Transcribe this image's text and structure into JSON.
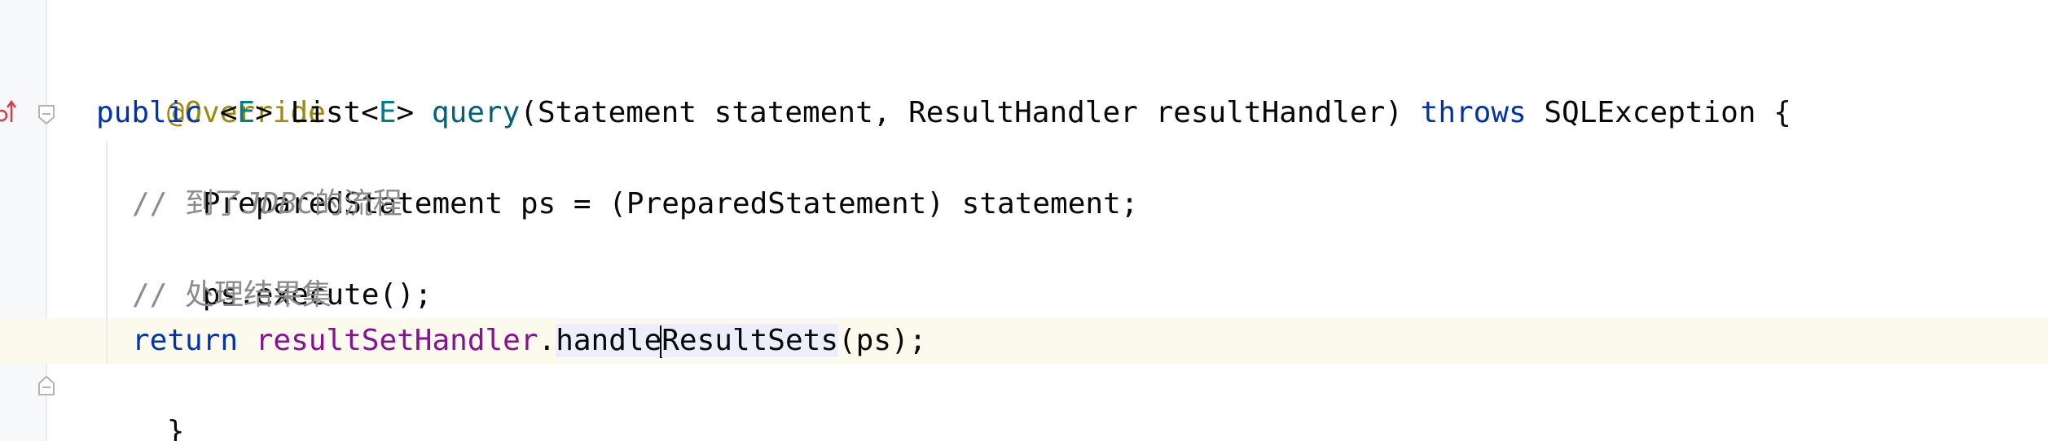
{
  "editor": {
    "lines": [
      {
        "annotation": "@Override"
      },
      {
        "kw_public": "public",
        "sp1": " ",
        "lt1": "<",
        "tp1": "E",
        "gt1": ">",
        "sp2": " List<",
        "tp2": "E",
        "gt2": "> ",
        "method": "query",
        "params": "(Statement statement, ResultHandler resultHandler) ",
        "kw_throws": "throws",
        "tail": " SQLException {"
      },
      {
        "text": "PreparedStatement ps = (PreparedStatement) statement;"
      },
      {
        "comment_prefix": "// ",
        "comment_cjk1": "到了",
        "comment_italic": "JDBC",
        "comment_cjk2": "的流程"
      },
      {
        "text": "ps.execute();"
      },
      {
        "comment_prefix": "// ",
        "comment_cjk": "处理结果集"
      },
      {
        "kw_return": "return",
        "sp": " ",
        "field": "resultSetHandler",
        "dot": ".",
        "method_part1": "handle",
        "method_part2": "ResultSets",
        "args": "(ps);"
      },
      {
        "text": "}"
      }
    ]
  },
  "gutter": {
    "override_icon": "override-up-arrow-icon",
    "fold_icon": "fold-icon"
  },
  "colors": {
    "keyword": "#0033b3",
    "annotation": "#9e880d",
    "type_param": "#007e8a",
    "method": "#00627a",
    "field": "#871094",
    "comment": "#8c8c8c",
    "current_line": "#fcfaed",
    "gutter_bg": "#f7f8fa"
  }
}
